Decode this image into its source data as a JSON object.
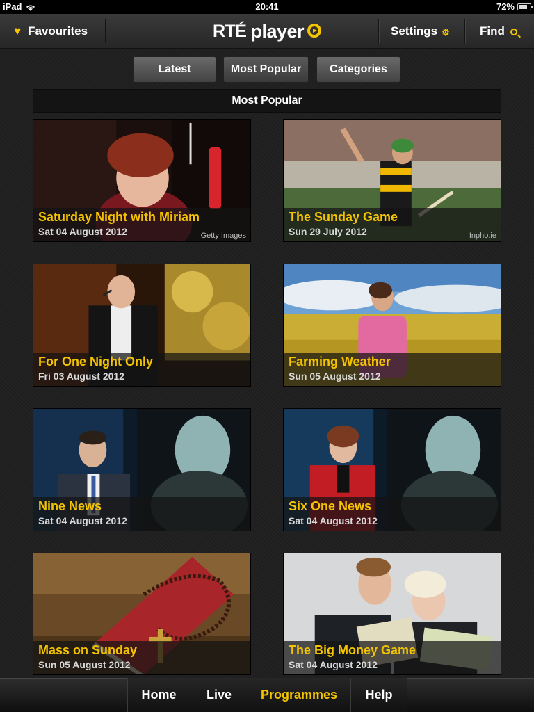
{
  "status_bar": {
    "carrier": "iPad",
    "time": "20:41",
    "battery": "72%"
  },
  "nav": {
    "favourites": "Favourites",
    "logo_rte": "RTÉ",
    "logo_player": "player",
    "settings": "Settings",
    "find": "Find"
  },
  "tabs": {
    "latest": "Latest",
    "most_popular": "Most Popular",
    "categories": "Categories",
    "active": "Most Popular"
  },
  "section": {
    "title": "Most Popular"
  },
  "programmes": [
    {
      "title": "Saturday Night with Miriam",
      "date": "Sat 04 August 2012",
      "credit": "Getty Images",
      "image_icon": "miriam-photo"
    },
    {
      "title": "The Sunday Game",
      "date": "Sun 29 July 2012",
      "credit": "Inpho.ie",
      "image_icon": "hurler-photo"
    },
    {
      "title": "For One Night Only",
      "date": "Fri 03 August 2012",
      "credit": "",
      "image_icon": "singer-photo"
    },
    {
      "title": "Farming Weather",
      "date": "Sun 05 August 2012",
      "credit": "",
      "image_icon": "field-photo"
    },
    {
      "title": "Nine News",
      "date": "Sat 04 August 2012",
      "credit": "",
      "image_icon": "newsreader-photo"
    },
    {
      "title": "Six One News",
      "date": "Sat 04 August 2012",
      "credit": "",
      "image_icon": "newsreader-photo"
    },
    {
      "title": "Mass on Sunday",
      "date": "Sun 05 August 2012",
      "credit": "",
      "image_icon": "bible-photo"
    },
    {
      "title": "The Big Money Game",
      "date": "Sat 04 August 2012",
      "credit": "",
      "image_icon": "presenters-photo"
    }
  ],
  "bottom_tabs": {
    "home": "Home",
    "live": "Live",
    "programmes": "Programmes",
    "help": "Help",
    "active": "Programmes"
  },
  "colors": {
    "accent": "#f5c400",
    "background": "#1c1c1c",
    "caption_date": "#d8d8d8"
  }
}
